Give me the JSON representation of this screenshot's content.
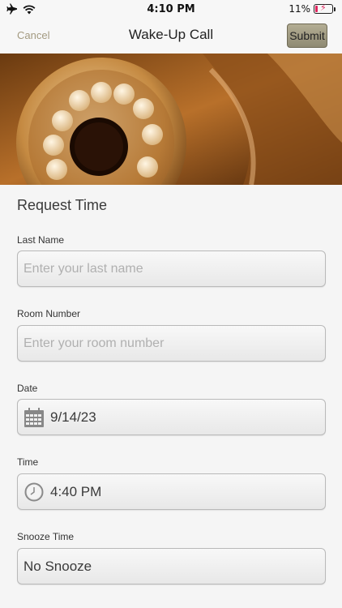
{
  "status_bar": {
    "time": "4:10 PM",
    "battery": "11%"
  },
  "nav": {
    "cancel_label": "Cancel",
    "title": "Wake-Up Call",
    "submit_label": "Submit"
  },
  "section": {
    "title": "Request Time"
  },
  "fields": {
    "last_name": {
      "label": "Last Name",
      "placeholder": "Enter your last name"
    },
    "room_number": {
      "label": "Room Number",
      "placeholder": "Enter your room number"
    },
    "date": {
      "label": "Date",
      "value": "9/14/23"
    },
    "time": {
      "label": "Time",
      "value": "4:40 PM"
    },
    "snooze": {
      "label": "Snooze Time",
      "value": "No Snooze"
    }
  },
  "colors": {
    "accent": "#a39a80",
    "submit_bg": "#a39f87",
    "hero_tint": "#b8702a"
  },
  "icons": [
    "airplane-icon",
    "wifi-icon",
    "battery-icon",
    "calendar-icon",
    "clock-icon"
  ]
}
